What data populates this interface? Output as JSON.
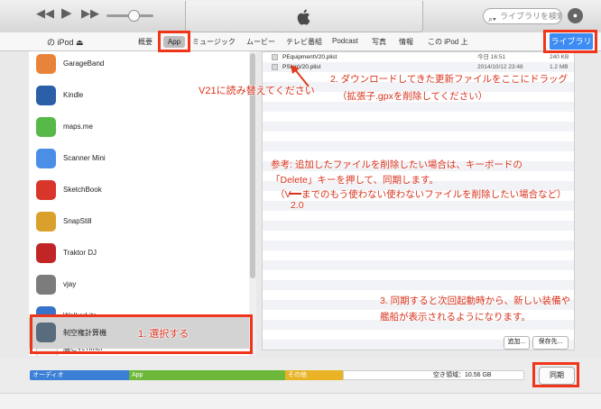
{
  "toolbar": {
    "prev_icon": "rewind-icon",
    "play_icon": "play-icon",
    "next_icon": "fast-forward-icon",
    "search_placeholder": "ライブラリを検索"
  },
  "tabbar": {
    "device": "の iPod ⏏",
    "tabs": [
      "概要",
      "App",
      "ミュージック",
      "ムービー",
      "テレビ番組",
      "Podcast",
      "写真",
      "情報",
      "この iPod 上"
    ],
    "library_button": "ライブラリ"
  },
  "apps": [
    {
      "name": "GarageBand",
      "color": "#e8843a"
    },
    {
      "name": "Kindle",
      "color": "#2b5fa8"
    },
    {
      "name": "maps.me",
      "color": "#57b947"
    },
    {
      "name": "Scanner Mini",
      "color": "#4a8ee6"
    },
    {
      "name": "SketchBook",
      "color": "#d9362b"
    },
    {
      "name": "SnapStill",
      "color": "#d9a12b"
    },
    {
      "name": "Traktor DJ",
      "color": "#c22525"
    },
    {
      "name": "vjay",
      "color": "#7c7c7c"
    },
    {
      "name": "WalkerLite",
      "color": "#3a72c9"
    },
    {
      "name": "艦これTimer",
      "color": "#f4f4f4"
    },
    {
      "name": "制空権計算機",
      "color": "#596c7d"
    }
  ],
  "files": [
    {
      "name": "PEquipmentV20.plist",
      "date": "今日 16:51",
      "size": "240 KB"
    },
    {
      "name": "PShipV20.plist",
      "date": "2014/10/12 23:48",
      "size": "1.2 MB"
    }
  ],
  "file_buttons": {
    "add": "追加...",
    "save": "保存先..."
  },
  "capacity": {
    "segments": [
      {
        "label": "オーディオ",
        "color": "#3b7fd6",
        "width_pct": 20
      },
      {
        "label": "App",
        "color": "#6db83a",
        "width_pct": 25
      },
      {
        "label": "その他",
        "color": "#e8b426",
        "width_pct": 15
      },
      {
        "label": "",
        "color": "#ffffff",
        "width_pct": 40
      }
    ],
    "free": "空き領域：10.56 GB",
    "sync": "同期"
  },
  "annotations": {
    "n1": "1. 選択する",
    "n2a": "2. ダウンロードしてきた更新ファイルをここにドラッグ",
    "n2b": "（拡張子.gpxを削除してください）",
    "v21": "V21に読み替えてください",
    "ref1": "参考: 追加したファイルを削除したい場合は、キーボードの",
    "ref2": "「Delete」キーを押して、同期します。",
    "ref3": "（V",
    "ref3b": "までのもう使わない使わないファイルを削除したい場合など）",
    "ref4": "2.0",
    "n3a": "3. 同期すると次回起動時から、新しい装備や",
    "n3b": "艦船が表示されるようになります。"
  }
}
